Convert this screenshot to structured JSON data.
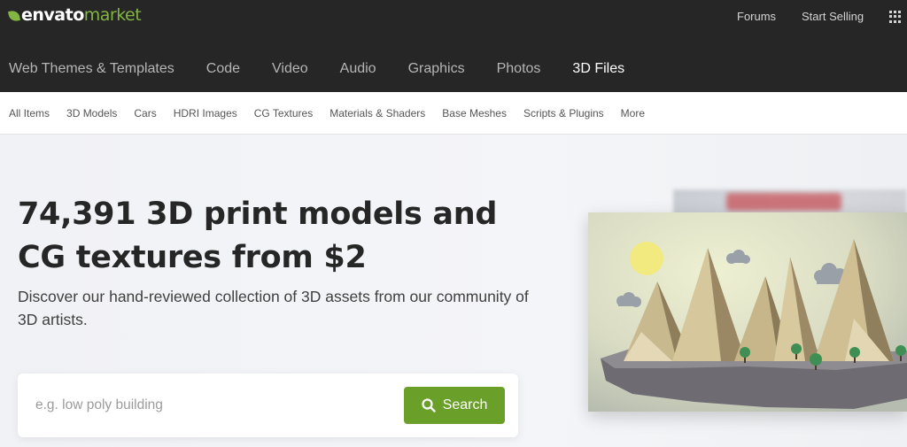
{
  "header": {
    "logo": {
      "brand": "envato",
      "product": "market"
    },
    "utility_links": [
      "Forums",
      "Start Selling"
    ],
    "categories": [
      {
        "label": "Web Themes & Templates",
        "active": false
      },
      {
        "label": "Code",
        "active": false
      },
      {
        "label": "Video",
        "active": false
      },
      {
        "label": "Audio",
        "active": false
      },
      {
        "label": "Graphics",
        "active": false
      },
      {
        "label": "Photos",
        "active": false
      },
      {
        "label": "3D Files",
        "active": true
      }
    ]
  },
  "subnav": {
    "items": [
      "All Items",
      "3D Models",
      "Cars",
      "HDRI Images",
      "CG Textures",
      "Materials & Shaders",
      "Base Meshes",
      "Scripts & Plugins",
      "More"
    ]
  },
  "hero": {
    "headline_line1": "74,391 3D print models and",
    "headline_line2": "CG textures from $2",
    "description": "Discover our hand-reviewed collection of 3D assets from our community of 3D artists.",
    "search": {
      "placeholder": "e.g. low poly building",
      "value": "",
      "button_label": "Search"
    }
  },
  "colors": {
    "header_bg": "#262626",
    "brand_green": "#82b541",
    "search_button": "#6a9f2a",
    "hero_bg": "#f3f4f7"
  },
  "icons": {
    "logo": "envato-leaf-icon",
    "apps": "grid-menu-icon",
    "search": "search-icon"
  }
}
